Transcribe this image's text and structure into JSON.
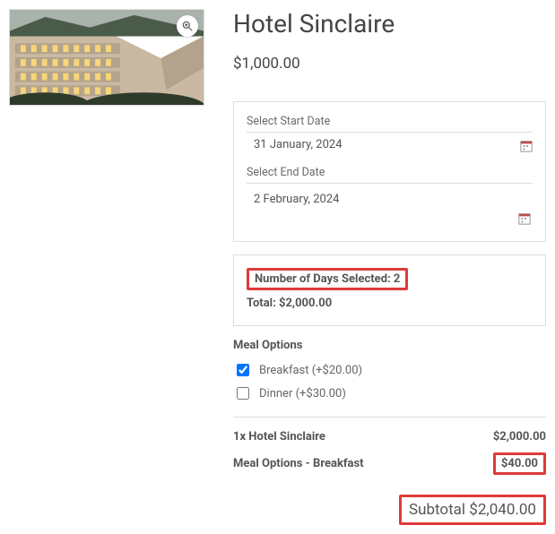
{
  "product": {
    "title": "Hotel Sinclaire",
    "price_display": "$1,000.00"
  },
  "dates": {
    "start_label": "Select Start Date",
    "start_value": "31 January, 2024",
    "end_label": "Select End Date",
    "end_value": "2 February, 2024"
  },
  "summary": {
    "days_label": "Number of Days Selected: 2",
    "total_label": "Total: $2,000.00"
  },
  "meal_options": {
    "heading": "Meal Options",
    "options": [
      {
        "label": "Breakfast (+$20.00)",
        "checked": true
      },
      {
        "label": "Dinner (+$30.00)",
        "checked": false
      }
    ]
  },
  "totals": {
    "lines": [
      {
        "label": "1x Hotel Sinclaire",
        "value": "$2,000.00",
        "highlight": false
      },
      {
        "label": "Meal Options - Breakfast",
        "value": "$40.00",
        "highlight": true
      }
    ],
    "subtotal_label": "Subtotal",
    "subtotal_value": "$2,040.00"
  }
}
